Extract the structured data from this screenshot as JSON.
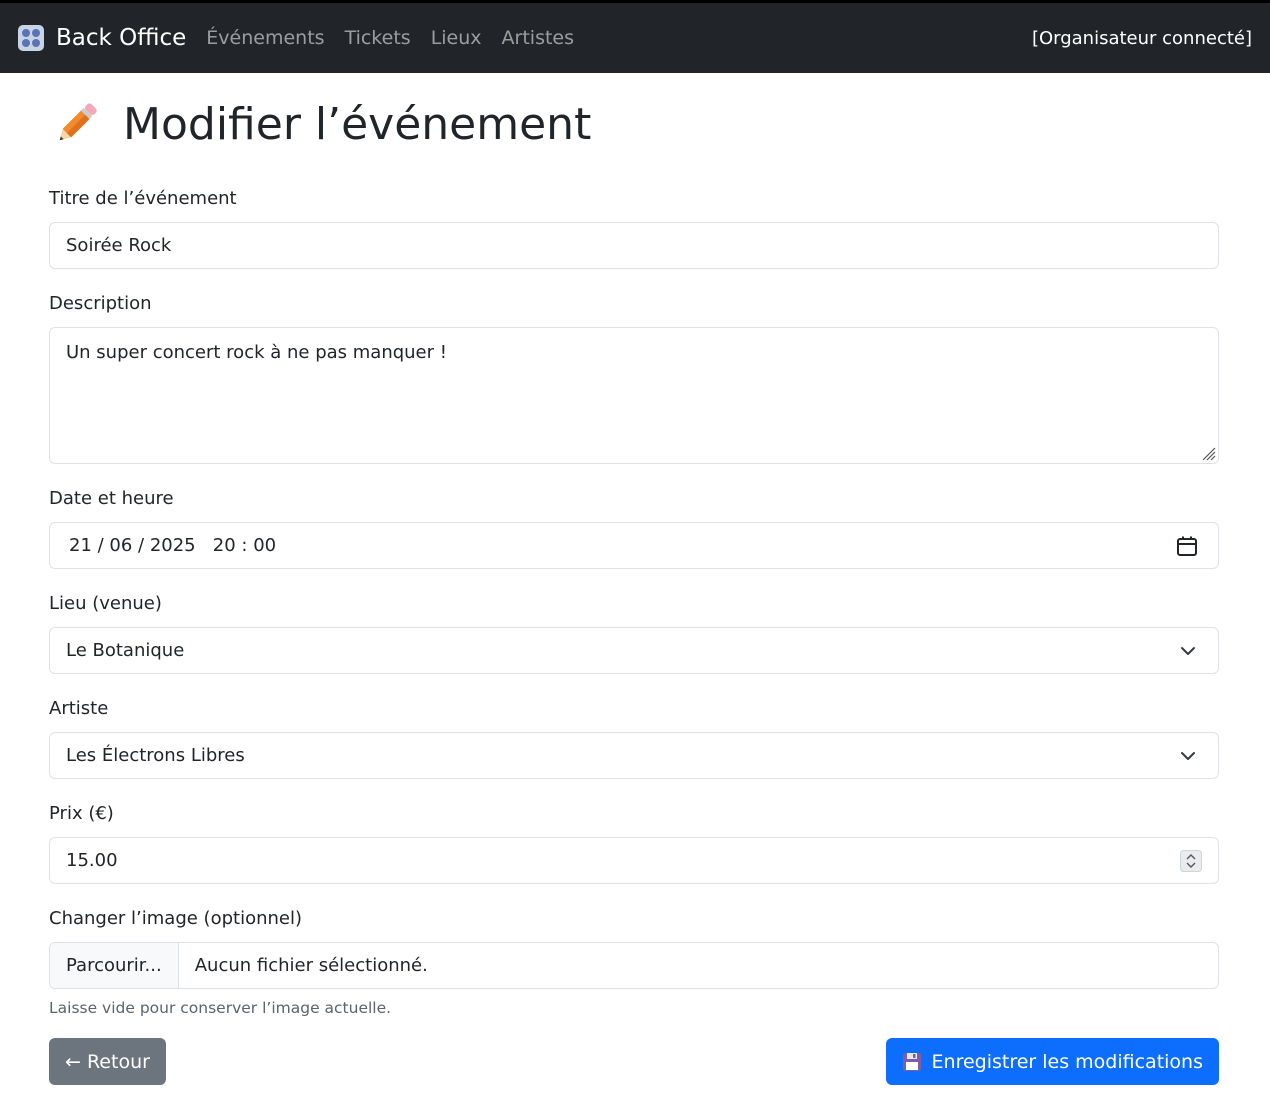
{
  "navbar": {
    "brand": "Back Office",
    "links": [
      "Événements",
      "Tickets",
      "Lieux",
      "Artistes"
    ],
    "user": "[Organisateur connecté]"
  },
  "page": {
    "title": "Modifier l’événement"
  },
  "form": {
    "title_label": "Titre de l’événement",
    "title_value": "Soirée Rock",
    "description_label": "Description",
    "description_value": "Un super concert rock à ne pas manquer !",
    "date_label": "Date et heure",
    "date_value": "21 / 06 / 2025   20 : 00",
    "venue_label": "Lieu (venue)",
    "venue_value": "Le Botanique",
    "artist_label": "Artiste",
    "artist_value": "Les Électrons Libres",
    "price_label": "Prix (€)",
    "price_value": "15.00",
    "image_label": "Changer l’image (optionnel)",
    "file_button": "Parcourir...",
    "file_status": "Aucun fichier sélectionné.",
    "image_help": "Laisse vide pour conserver l’image actuelle."
  },
  "actions": {
    "back_label": "← Retour",
    "save_label": "Enregistrer les modifications"
  },
  "colors": {
    "navbar_bg": "#212529",
    "primary": "#0d6efd",
    "secondary": "#6c757d"
  }
}
